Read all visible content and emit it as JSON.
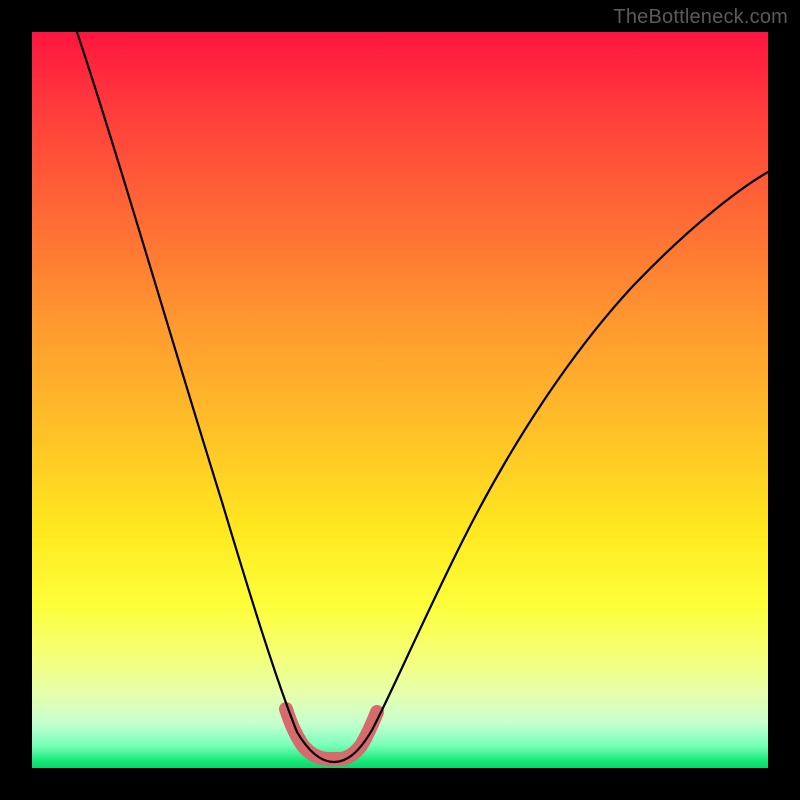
{
  "watermark": "TheBottleneck.com",
  "colors": {
    "background_frame": "#000000",
    "gradient_top": "#ff153f",
    "gradient_mid": "#ffe91f",
    "gradient_bottom": "#0bd46e",
    "curve": "#000000",
    "highlight": "#d66a6d"
  },
  "chart_data": {
    "type": "line",
    "title": "",
    "xlabel": "",
    "ylabel": "",
    "xlim": [
      0,
      100
    ],
    "ylim": [
      0,
      100
    ],
    "grid": false,
    "legend": false,
    "series": [
      {
        "name": "bottleneck-curve",
        "x": [
          6,
          10,
          15,
          20,
          25,
          28,
          30,
          32,
          34,
          35.5,
          37,
          38,
          39,
          40,
          41,
          42,
          44,
          46,
          50,
          55,
          60,
          65,
          70,
          75,
          80,
          85,
          90,
          95,
          100
        ],
        "y": [
          100,
          87,
          72,
          56,
          40,
          30,
          23,
          16,
          10,
          6,
          3,
          1.8,
          1.2,
          1,
          1.2,
          1.8,
          4,
          8,
          16,
          26,
          34,
          41,
          48,
          53,
          58,
          63,
          67,
          70,
          73
        ],
        "note": "y = bottleneck percentage (0 at green bottom, 100 at red top); x = relative component scaling. Values read from vertical gradient position."
      },
      {
        "name": "optimal-range-highlight",
        "x": [
          34.5,
          36,
          38,
          40,
          42,
          44,
          45.5
        ],
        "y": [
          8,
          4,
          1.6,
          1,
          1.6,
          4,
          7
        ],
        "note": "Thick salmon overlay marking the near-zero-bottleneck valley."
      }
    ]
  }
}
